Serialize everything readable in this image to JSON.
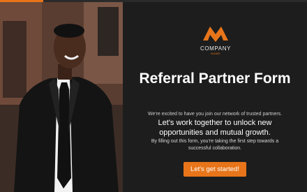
{
  "progress": {
    "percent": 14
  },
  "hero": {
    "image_description_name": "portrait-photo"
  },
  "logo": {
    "name": "COMPANY",
    "tagline": "NAME",
    "icon": "m-logo-icon"
  },
  "content": {
    "title": "Referral Partner Form",
    "intro": "We're excited to have you join our network of trusted partners.",
    "lead": "Let's work together to unlock new opportunities and mutual growth.",
    "note": "By filling out this form, you're taking the first step towards a successful collaboration."
  },
  "cta": {
    "label": "Let's get started!"
  },
  "colors": {
    "accent": "#e8751a",
    "panel": "#1d1d1d",
    "text": "#ffffff"
  }
}
